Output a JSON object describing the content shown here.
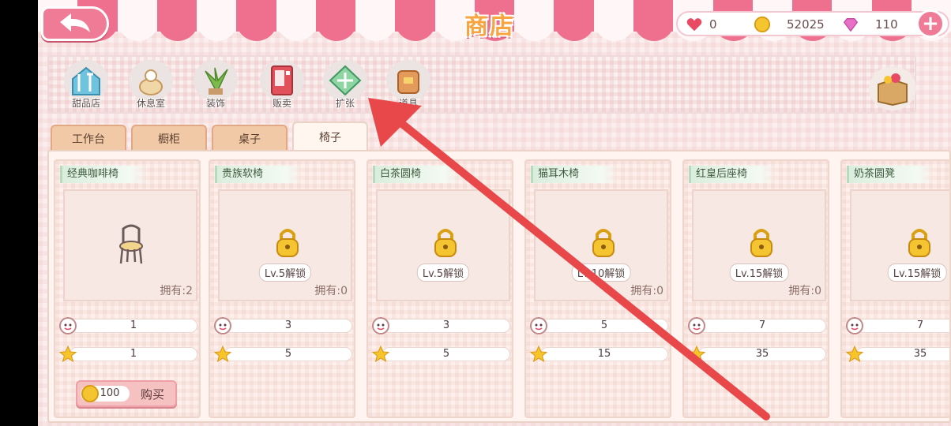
{
  "header": {
    "title": "商店",
    "hearts": "0",
    "coins": "52025",
    "gems": "110",
    "plus_label": "+"
  },
  "categories": [
    {
      "label": "甜品店",
      "icon": "dessert-shop-icon"
    },
    {
      "label": "休息室",
      "icon": "lounge-icon"
    },
    {
      "label": "装饰",
      "icon": "decoration-plant-icon"
    },
    {
      "label": "贩卖",
      "icon": "vending-machine-icon"
    },
    {
      "label": "扩张",
      "icon": "expand-icon"
    },
    {
      "label": "道具",
      "icon": "item-bag-icon"
    }
  ],
  "tabs": [
    {
      "label": "工作台",
      "active": false
    },
    {
      "label": "橱柜",
      "active": false
    },
    {
      "label": "桌子",
      "active": false
    },
    {
      "label": "椅子",
      "active": true
    }
  ],
  "items": [
    {
      "name": "经典咖啡椅",
      "locked": false,
      "lock_text": "",
      "owned": "拥有:2",
      "charm": "1",
      "stars": "1"
    },
    {
      "name": "贵族软椅",
      "locked": true,
      "lock_text": "Lv.5解锁",
      "owned": "拥有:0",
      "charm": "3",
      "stars": "5"
    },
    {
      "name": "白茶圆椅",
      "locked": true,
      "lock_text": "Lv.5解锁",
      "owned": "",
      "charm": "3",
      "stars": "5"
    },
    {
      "name": "猫耳木椅",
      "locked": true,
      "lock_text": "Lv.10解锁",
      "owned": "拥有:0",
      "charm": "5",
      "stars": "15"
    },
    {
      "name": "红皇后座椅",
      "locked": true,
      "lock_text": "Lv.15解锁",
      "owned": "拥有:0",
      "charm": "7",
      "stars": "35"
    },
    {
      "name": "奶茶圆凳",
      "locked": true,
      "lock_text": "Lv.15解锁",
      "owned": "",
      "charm": "7",
      "stars": "35"
    }
  ],
  "buy_button": {
    "price": "100",
    "label": "购买"
  },
  "colors": {
    "awning_pink": "#ef6f8e",
    "accent_coin": "#f5c531",
    "star": "#f7c52b",
    "heart": "#e84a63",
    "gem": "#e76fc5",
    "annotation_arrow": "#e8484a"
  }
}
